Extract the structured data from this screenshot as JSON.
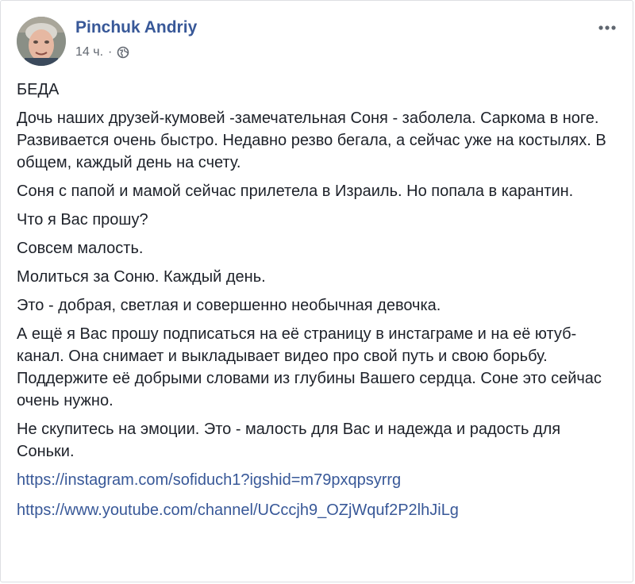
{
  "post": {
    "author": "Pinchuk Andriy",
    "time": "14 ч.",
    "separator": "·",
    "privacy_icon": "globe-icon",
    "more_icon": "more-options-icon",
    "title": "БЕДА",
    "paragraphs": [
      "Дочь наших друзей-кумовей -замечательная Соня - заболела. Саркома в ноге. Развивается очень быстро. Недавно резво бегала, а сейчас уже на костылях. В общем, каждый день на счету.",
      "Соня с папой и мамой сейчас прилетела в Израиль. Но попала в карантин.",
      "Что я Вас прошу?",
      "Совсем малость.",
      "Молиться за Соню. Каждый день.",
      "Это - добрая, светлая и совершенно необычная девочка.",
      "А ещё я Вас прошу подписаться на её страницу в инстаграме и на её ютуб-канал. Она снимает и выкладывает видео про свой путь и свою борьбу. Поддержите её добрыми словами из глубины Вашего сердца. Соне это сейчас очень нужно.",
      "Не скупитесь на эмоции. Это - малость для Вас и надежда и радость для Соньки."
    ],
    "links": [
      "https://instagram.com/sofiduch1?igshid=m79pxqpsyrrg",
      "https://www.youtube.com/channel/UCccjh9_OZjWquf2P2lhJiLg"
    ]
  },
  "colors": {
    "author": "#385898",
    "meta": "#616770",
    "text": "#1d2129",
    "link": "#385898",
    "border": "#dddfe2"
  }
}
